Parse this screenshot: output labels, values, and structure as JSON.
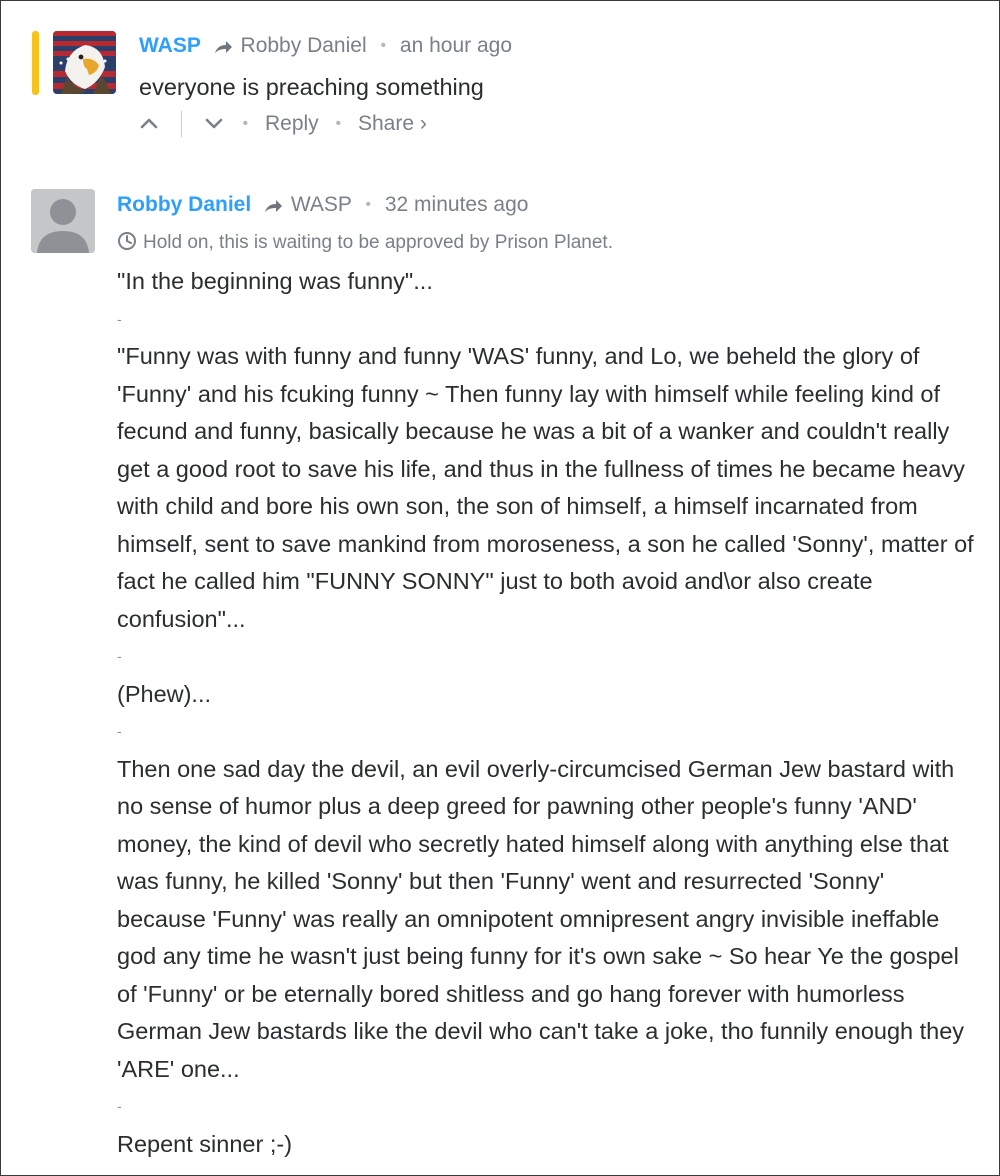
{
  "thread": {
    "parent": {
      "author": "WASP",
      "in_reply_to": "Robby Daniel",
      "time": "an hour ago",
      "message": "everyone is preaching something",
      "footer": {
        "reply_label": "Reply",
        "share_label": "Share ›"
      },
      "avatar_icon": "eagle-flag-icon",
      "highlight_color": "#f7c21b"
    },
    "reply": {
      "author": "Robby Daniel",
      "in_reply_to": "WASP",
      "time": "32 minutes ago",
      "pending_notice": "Hold on, this is waiting to be approved by Prison Planet.",
      "avatar_icon": "default-user-avatar-icon",
      "paragraphs": [
        "\"In the beginning was funny\"...",
        "-",
        "\"Funny was with funny and funny 'WAS' funny, and Lo, we beheld the glory of 'Funny' and his fcuking funny ~ Then funny lay with himself while feeling kind of fecund and funny, basically because he was a bit of a wanker and couldn't really get a good root to save his life, and thus in the fullness of times he became heavy with child and bore his own son, the son of himself, a himself incarnated from himself, sent to save mankind from moroseness, a son he called 'Sonny', matter of fact he called him \"FUNNY SONNY\" just to both avoid and\\or also create confusion\"...",
        "-",
        "(Phew)...",
        "-",
        "Then one sad day the devil, an evil overly-circumcised German Jew bastard with no sense of humor plus a deep greed for pawning other people's funny 'AND' money, the kind of devil who secretly hated himself along with anything else that was funny, he killed 'Sonny' but then 'Funny' went and resurrected 'Sonny' because 'Funny' was really an omnipotent omnipresent angry invisible ineffable god any time he wasn't just being funny for it's own sake ~ So hear Ye the gospel of 'Funny' or be eternally bored shitless and go hang forever with humorless German Jew bastards like the devil who can't take a joke, tho funnily enough they 'ARE' one...",
        "-",
        "Repent sinner ;-)"
      ]
    }
  },
  "colors": {
    "author_link": "#2e9fff",
    "meta_text": "#7a8088",
    "body_text": "#2a2e2e"
  }
}
